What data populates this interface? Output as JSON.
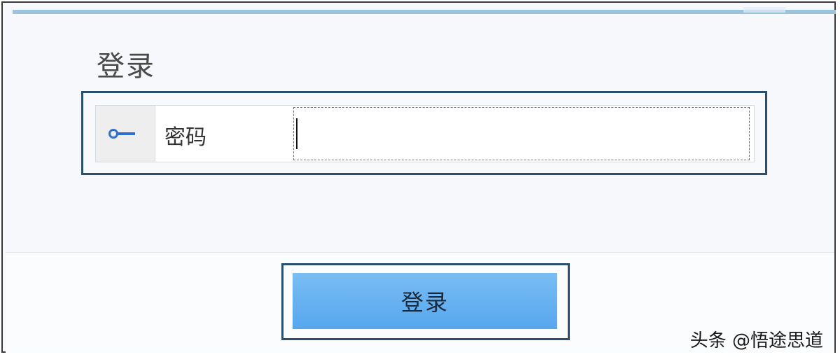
{
  "form": {
    "title": "登录",
    "password_label": "密码",
    "password_value": "",
    "submit_label": "登录"
  },
  "icons": {
    "field_icon": "key-icon"
  },
  "colors": {
    "accent": "#56a6ee",
    "border": "#2b4f6e",
    "key_icon": "#2e6fd2"
  },
  "watermark": {
    "text": "头条 @悟途思道"
  }
}
